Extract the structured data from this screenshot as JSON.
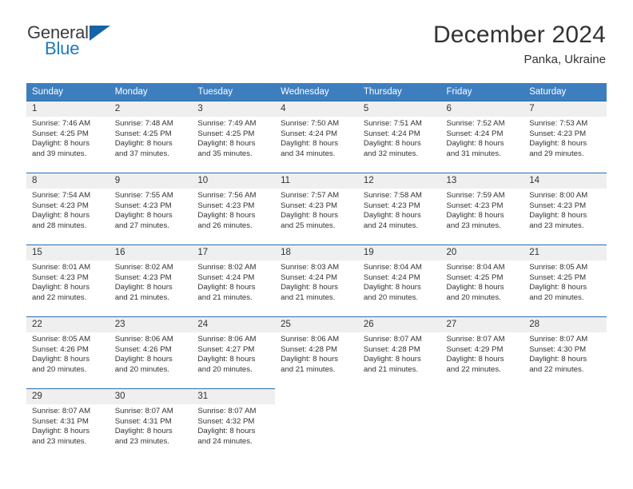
{
  "brand": {
    "name_top": "General",
    "name_bottom": "Blue",
    "triangle_color": "#1464a5",
    "blue_color": "#1c7ac0"
  },
  "header": {
    "month_title": "December 2024",
    "location": "Panka, Ukraine"
  },
  "theme": {
    "header_blue": "#3d7ebf",
    "row_rule_blue": "#2b6eb1",
    "daynum_bg": "#efefef",
    "text": "#333333"
  },
  "weekdays": [
    "Sunday",
    "Monday",
    "Tuesday",
    "Wednesday",
    "Thursday",
    "Friday",
    "Saturday"
  ],
  "weeks": [
    [
      {
        "day": "1",
        "sunrise": "Sunrise: 7:46 AM",
        "sunset": "Sunset: 4:25 PM",
        "daylight1": "Daylight: 8 hours",
        "daylight2": "and 39 minutes."
      },
      {
        "day": "2",
        "sunrise": "Sunrise: 7:48 AM",
        "sunset": "Sunset: 4:25 PM",
        "daylight1": "Daylight: 8 hours",
        "daylight2": "and 37 minutes."
      },
      {
        "day": "3",
        "sunrise": "Sunrise: 7:49 AM",
        "sunset": "Sunset: 4:25 PM",
        "daylight1": "Daylight: 8 hours",
        "daylight2": "and 35 minutes."
      },
      {
        "day": "4",
        "sunrise": "Sunrise: 7:50 AM",
        "sunset": "Sunset: 4:24 PM",
        "daylight1": "Daylight: 8 hours",
        "daylight2": "and 34 minutes."
      },
      {
        "day": "5",
        "sunrise": "Sunrise: 7:51 AM",
        "sunset": "Sunset: 4:24 PM",
        "daylight1": "Daylight: 8 hours",
        "daylight2": "and 32 minutes."
      },
      {
        "day": "6",
        "sunrise": "Sunrise: 7:52 AM",
        "sunset": "Sunset: 4:24 PM",
        "daylight1": "Daylight: 8 hours",
        "daylight2": "and 31 minutes."
      },
      {
        "day": "7",
        "sunrise": "Sunrise: 7:53 AM",
        "sunset": "Sunset: 4:23 PM",
        "daylight1": "Daylight: 8 hours",
        "daylight2": "and 29 minutes."
      }
    ],
    [
      {
        "day": "8",
        "sunrise": "Sunrise: 7:54 AM",
        "sunset": "Sunset: 4:23 PM",
        "daylight1": "Daylight: 8 hours",
        "daylight2": "and 28 minutes."
      },
      {
        "day": "9",
        "sunrise": "Sunrise: 7:55 AM",
        "sunset": "Sunset: 4:23 PM",
        "daylight1": "Daylight: 8 hours",
        "daylight2": "and 27 minutes."
      },
      {
        "day": "10",
        "sunrise": "Sunrise: 7:56 AM",
        "sunset": "Sunset: 4:23 PM",
        "daylight1": "Daylight: 8 hours",
        "daylight2": "and 26 minutes."
      },
      {
        "day": "11",
        "sunrise": "Sunrise: 7:57 AM",
        "sunset": "Sunset: 4:23 PM",
        "daylight1": "Daylight: 8 hours",
        "daylight2": "and 25 minutes."
      },
      {
        "day": "12",
        "sunrise": "Sunrise: 7:58 AM",
        "sunset": "Sunset: 4:23 PM",
        "daylight1": "Daylight: 8 hours",
        "daylight2": "and 24 minutes."
      },
      {
        "day": "13",
        "sunrise": "Sunrise: 7:59 AM",
        "sunset": "Sunset: 4:23 PM",
        "daylight1": "Daylight: 8 hours",
        "daylight2": "and 23 minutes."
      },
      {
        "day": "14",
        "sunrise": "Sunrise: 8:00 AM",
        "sunset": "Sunset: 4:23 PM",
        "daylight1": "Daylight: 8 hours",
        "daylight2": "and 23 minutes."
      }
    ],
    [
      {
        "day": "15",
        "sunrise": "Sunrise: 8:01 AM",
        "sunset": "Sunset: 4:23 PM",
        "daylight1": "Daylight: 8 hours",
        "daylight2": "and 22 minutes."
      },
      {
        "day": "16",
        "sunrise": "Sunrise: 8:02 AM",
        "sunset": "Sunset: 4:23 PM",
        "daylight1": "Daylight: 8 hours",
        "daylight2": "and 21 minutes."
      },
      {
        "day": "17",
        "sunrise": "Sunrise: 8:02 AM",
        "sunset": "Sunset: 4:24 PM",
        "daylight1": "Daylight: 8 hours",
        "daylight2": "and 21 minutes."
      },
      {
        "day": "18",
        "sunrise": "Sunrise: 8:03 AM",
        "sunset": "Sunset: 4:24 PM",
        "daylight1": "Daylight: 8 hours",
        "daylight2": "and 21 minutes."
      },
      {
        "day": "19",
        "sunrise": "Sunrise: 8:04 AM",
        "sunset": "Sunset: 4:24 PM",
        "daylight1": "Daylight: 8 hours",
        "daylight2": "and 20 minutes."
      },
      {
        "day": "20",
        "sunrise": "Sunrise: 8:04 AM",
        "sunset": "Sunset: 4:25 PM",
        "daylight1": "Daylight: 8 hours",
        "daylight2": "and 20 minutes."
      },
      {
        "day": "21",
        "sunrise": "Sunrise: 8:05 AM",
        "sunset": "Sunset: 4:25 PM",
        "daylight1": "Daylight: 8 hours",
        "daylight2": "and 20 minutes."
      }
    ],
    [
      {
        "day": "22",
        "sunrise": "Sunrise: 8:05 AM",
        "sunset": "Sunset: 4:26 PM",
        "daylight1": "Daylight: 8 hours",
        "daylight2": "and 20 minutes."
      },
      {
        "day": "23",
        "sunrise": "Sunrise: 8:06 AM",
        "sunset": "Sunset: 4:26 PM",
        "daylight1": "Daylight: 8 hours",
        "daylight2": "and 20 minutes."
      },
      {
        "day": "24",
        "sunrise": "Sunrise: 8:06 AM",
        "sunset": "Sunset: 4:27 PM",
        "daylight1": "Daylight: 8 hours",
        "daylight2": "and 20 minutes."
      },
      {
        "day": "25",
        "sunrise": "Sunrise: 8:06 AM",
        "sunset": "Sunset: 4:28 PM",
        "daylight1": "Daylight: 8 hours",
        "daylight2": "and 21 minutes."
      },
      {
        "day": "26",
        "sunrise": "Sunrise: 8:07 AM",
        "sunset": "Sunset: 4:28 PM",
        "daylight1": "Daylight: 8 hours",
        "daylight2": "and 21 minutes."
      },
      {
        "day": "27",
        "sunrise": "Sunrise: 8:07 AM",
        "sunset": "Sunset: 4:29 PM",
        "daylight1": "Daylight: 8 hours",
        "daylight2": "and 22 minutes."
      },
      {
        "day": "28",
        "sunrise": "Sunrise: 8:07 AM",
        "sunset": "Sunset: 4:30 PM",
        "daylight1": "Daylight: 8 hours",
        "daylight2": "and 22 minutes."
      }
    ],
    [
      {
        "day": "29",
        "sunrise": "Sunrise: 8:07 AM",
        "sunset": "Sunset: 4:31 PM",
        "daylight1": "Daylight: 8 hours",
        "daylight2": "and 23 minutes."
      },
      {
        "day": "30",
        "sunrise": "Sunrise: 8:07 AM",
        "sunset": "Sunset: 4:31 PM",
        "daylight1": "Daylight: 8 hours",
        "daylight2": "and 23 minutes."
      },
      {
        "day": "31",
        "sunrise": "Sunrise: 8:07 AM",
        "sunset": "Sunset: 4:32 PM",
        "daylight1": "Daylight: 8 hours",
        "daylight2": "and 24 minutes."
      },
      {
        "day": "",
        "sunrise": "",
        "sunset": "",
        "daylight1": "",
        "daylight2": ""
      },
      {
        "day": "",
        "sunrise": "",
        "sunset": "",
        "daylight1": "",
        "daylight2": ""
      },
      {
        "day": "",
        "sunrise": "",
        "sunset": "",
        "daylight1": "",
        "daylight2": ""
      },
      {
        "day": "",
        "sunrise": "",
        "sunset": "",
        "daylight1": "",
        "daylight2": ""
      }
    ]
  ]
}
